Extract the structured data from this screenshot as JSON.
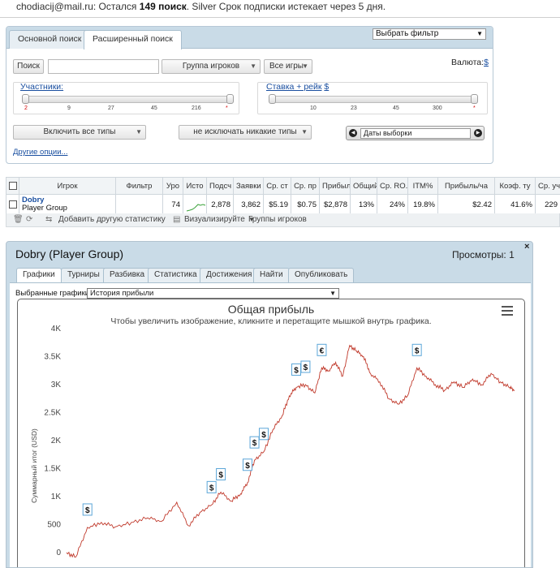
{
  "topbar": {
    "email": "chodiacij@mail.ru:",
    "text_remaining": " Остался ",
    "count": "149 поиск",
    "text_after": ". Silver Срок подписки истекает через 5 дня."
  },
  "search": {
    "tabs": [
      "Основной поиск",
      "Расширенный поиск"
    ],
    "active_tab": 1,
    "filter_select": "Выбрать фильтр",
    "search_button": "Поиск",
    "search_value": "",
    "player_groups_button": "Группа игроков",
    "all_games_button": "Все игры",
    "currency_label": "Валюта:",
    "currency_value": "$",
    "participants_label": "Участники:",
    "participants_ticks": [
      "2",
      "9",
      "27",
      "45",
      "216",
      "*"
    ],
    "stake_label": "Ставка + рейк",
    "stake_currency": "$",
    "stake_ticks": [
      "10",
      "23",
      "45",
      "300",
      "*"
    ],
    "include_types_button": "Включить все типы",
    "exclude_types_button": "не исключать никакие типы",
    "dates_value": "Даты выборки",
    "other_options_link": "Другие опции..."
  },
  "stats_table": {
    "columns": [
      "Игрок",
      "Фильтр",
      "Уро",
      "Исто",
      "Подсч",
      "Заявки",
      "Ср. ст",
      "Ср. пр",
      "Прибыл",
      "Общий",
      "Ср. RO.",
      "ITM%",
      "Прибыль/ча",
      "Коэф. ту",
      "Ср. уч"
    ],
    "rows": [
      {
        "player": "Dobry",
        "group": "Player Group",
        "filter": "",
        "level": "74",
        "count": "2,878",
        "entries": "3,862",
        "avg_stake": "$5.19",
        "avg_profit": "$0.75",
        "profit": "$2,878",
        "total": "13%",
        "avg_roi": "24%",
        "itm": "19.8%",
        "profit_per_hour": "$2.42",
        "ratio": "41.6%",
        "avg_participants": "229"
      }
    ]
  },
  "table_toolbar": {
    "add_stat": "Добавить другую статистику",
    "visualize": "Визуализируйте",
    "player_groups": "Группы игроков"
  },
  "player_panel": {
    "title": "Dobry (Player Group)",
    "views": "Просмотры: 1",
    "close": "×",
    "tabs": [
      "Графики",
      "Турниры",
      "Разбивка",
      "Статистика",
      "Достижения",
      "Найти",
      "Опубликовать"
    ],
    "active_tab": 0,
    "graphs_label": "Выбранные графики:",
    "graphs_value": "История прибыли"
  },
  "chart_data": {
    "type": "line",
    "title": "Общая прибыль",
    "subtitle": "Чтобы увеличить изображение, кликните и перетащите мышкой внутрь графика.",
    "ylabel": "Суммарный итог (USD)",
    "ylim": [
      0,
      4000
    ],
    "y_ticks": [
      "0",
      "500",
      "1K",
      "1.5K",
      "2K",
      "2.5K",
      "3K",
      "3.5K",
      "4K"
    ],
    "series_color": "#c0392b",
    "series": [
      {
        "x": [
          0,
          80,
          180,
          300,
          420,
          560,
          700,
          820,
          950,
          1050,
          1150,
          1250,
          1330,
          1420,
          1500,
          1560,
          1620,
          1700,
          1780,
          1860,
          1920,
          1980,
          2060,
          2140,
          2200,
          2260,
          2320,
          2380,
          2440,
          2500,
          2560,
          2620,
          2700,
          2780,
          2860,
          2940,
          3020,
          3100,
          3180,
          3260,
          3340,
          3420,
          3500,
          3580,
          3660,
          3740,
          3820,
          3862
        ],
        "y": [
          0,
          -80,
          450,
          540,
          460,
          540,
          620,
          560,
          900,
          480,
          720,
          850,
          1080,
          920,
          1050,
          1250,
          1650,
          1800,
          2200,
          2450,
          2800,
          2950,
          3000,
          2850,
          3300,
          3250,
          3400,
          3150,
          3700,
          3600,
          3500,
          3200,
          3050,
          2750,
          2650,
          2800,
          3300,
          3150,
          3000,
          2900,
          3050,
          2950,
          3100,
          3000,
          3200,
          3050,
          2950,
          2900
        ]
      }
    ],
    "markers": [
      {
        "x": 180,
        "y": 450,
        "label": "$"
      },
      {
        "x": 1250,
        "y": 850,
        "label": "$"
      },
      {
        "x": 1330,
        "y": 1080,
        "label": "$"
      },
      {
        "x": 1560,
        "y": 1250,
        "label": "$"
      },
      {
        "x": 1620,
        "y": 1650,
        "label": "$"
      },
      {
        "x": 1700,
        "y": 1800,
        "label": "$"
      },
      {
        "x": 1980,
        "y": 2950,
        "label": "$"
      },
      {
        "x": 2060,
        "y": 3000,
        "label": "$"
      },
      {
        "x": 2200,
        "y": 3300,
        "label": "€"
      },
      {
        "x": 3020,
        "y": 3300,
        "label": "$"
      }
    ]
  }
}
